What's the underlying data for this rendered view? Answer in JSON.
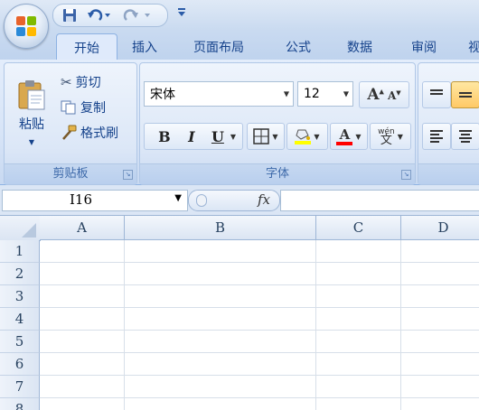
{
  "quick_access": {
    "save_icon": "save-icon",
    "undo_icon": "undo-icon",
    "redo_icon": "redo-icon",
    "customize_icon": "customize-qat-icon"
  },
  "tabs": [
    {
      "label": "开始",
      "active": true
    },
    {
      "label": "插入"
    },
    {
      "label": "页面布局"
    },
    {
      "label": "公式"
    },
    {
      "label": "数据"
    },
    {
      "label": "审阅"
    },
    {
      "label": "视"
    }
  ],
  "clipboard": {
    "paste_label": "粘贴",
    "cut_label": "剪切",
    "copy_label": "复制",
    "format_painter_label": "格式刷",
    "group_label": "剪贴板"
  },
  "font": {
    "font_name": "宋体",
    "font_size": "12",
    "grow_label": "A",
    "shrink_label": "A",
    "bold_label": "B",
    "italic_label": "I",
    "underline_label": "U",
    "phonetic_top": "wén",
    "phonetic_char": "文",
    "font_color_label": "A",
    "group_label": "字体"
  },
  "colors": {
    "highlight": "#ffff00",
    "font_color": "#ff0000",
    "accent": "#15428b"
  },
  "formula_bar": {
    "name_box": "I16",
    "fx_label": "fx",
    "formula": ""
  },
  "sheet": {
    "columns": [
      "A",
      "B",
      "C",
      "D"
    ],
    "rows": [
      "1",
      "2",
      "3",
      "4",
      "5",
      "6",
      "7",
      "8"
    ]
  }
}
